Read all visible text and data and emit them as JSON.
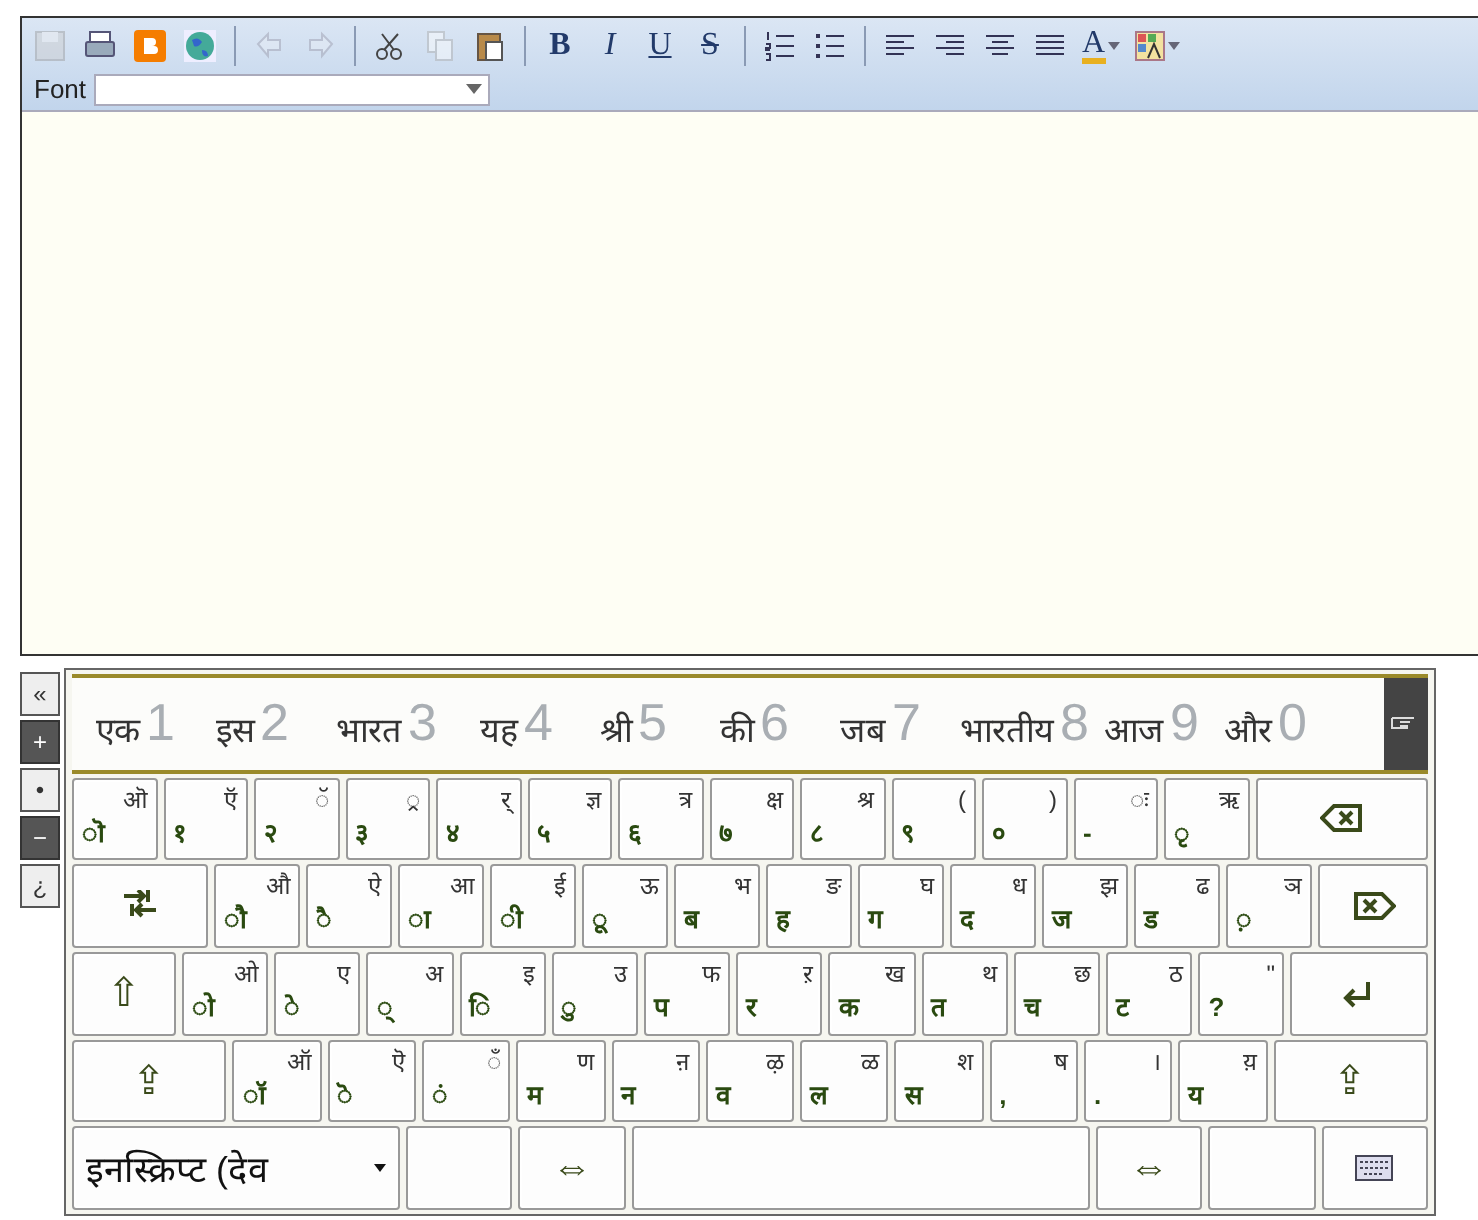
{
  "toolbar": {
    "buttons": [
      {
        "kind": "save",
        "disabled": true
      },
      {
        "kind": "print",
        "disabled": false
      },
      {
        "kind": "blog",
        "disabled": false
      },
      {
        "kind": "globe",
        "disabled": false
      },
      {
        "kind": "sep"
      },
      {
        "kind": "undo",
        "disabled": true
      },
      {
        "kind": "redo",
        "disabled": true
      },
      {
        "kind": "sep"
      },
      {
        "kind": "cut",
        "disabled": false
      },
      {
        "kind": "copy",
        "disabled": true
      },
      {
        "kind": "paste",
        "disabled": false
      },
      {
        "kind": "sep"
      },
      {
        "kind": "bold",
        "label": "B"
      },
      {
        "kind": "italic",
        "label": "I"
      },
      {
        "kind": "underline",
        "label": "U"
      },
      {
        "kind": "strike",
        "label": "S"
      },
      {
        "kind": "sep"
      },
      {
        "kind": "ordered-list",
        "disabled": false
      },
      {
        "kind": "bullet-list",
        "disabled": false
      },
      {
        "kind": "sep"
      },
      {
        "kind": "align-left",
        "disabled": false
      },
      {
        "kind": "align-right",
        "disabled": false
      },
      {
        "kind": "align-center",
        "disabled": false
      },
      {
        "kind": "justify",
        "disabled": false
      },
      {
        "kind": "font-color",
        "label": "A"
      },
      {
        "kind": "highlight"
      }
    ],
    "font": {
      "label": "Font"
    }
  },
  "side_buttons": [
    "«",
    "+",
    "•",
    "−",
    "¿"
  ],
  "suggestions": [
    {
      "word": "एक",
      "hint": "1"
    },
    {
      "word": "इस",
      "hint": "2"
    },
    {
      "word": "भारत",
      "hint": "3"
    },
    {
      "word": "यह",
      "hint": "4"
    },
    {
      "word": "श्री",
      "hint": "5"
    },
    {
      "word": "की",
      "hint": "6"
    },
    {
      "word": "जब",
      "hint": "7"
    },
    {
      "word": "भारतीय",
      "hint": "8"
    },
    {
      "word": "आज",
      "hint": "9"
    },
    {
      "word": "और",
      "hint": "0"
    }
  ],
  "keys": [
    [
      {
        "kind": "char",
        "lower": "ॊ",
        "upper": "ऒ"
      },
      {
        "kind": "char",
        "lower": "१",
        "upper": "ऍ"
      },
      {
        "kind": "char",
        "lower": "२",
        "upper": "ॅ"
      },
      {
        "kind": "char",
        "lower": "३",
        "upper": "्र"
      },
      {
        "kind": "char",
        "lower": "४",
        "upper": "र्"
      },
      {
        "kind": "char",
        "lower": "५",
        "upper": "ज्ञ"
      },
      {
        "kind": "char",
        "lower": "६",
        "upper": "त्र"
      },
      {
        "kind": "char",
        "lower": "७",
        "upper": "क्ष"
      },
      {
        "kind": "char",
        "lower": "८",
        "upper": "श्र"
      },
      {
        "kind": "char",
        "lower": "९",
        "upper": "("
      },
      {
        "kind": "char",
        "lower": "०",
        "upper": ")"
      },
      {
        "kind": "char",
        "lower": "-",
        "upper": "ः"
      },
      {
        "kind": "char",
        "lower": "ृ",
        "upper": "ऋ"
      },
      {
        "kind": "backspace"
      }
    ],
    [
      {
        "kind": "tab"
      },
      {
        "kind": "char",
        "lower": "ौ",
        "upper": "औ"
      },
      {
        "kind": "char",
        "lower": "ै",
        "upper": "ऐ"
      },
      {
        "kind": "char",
        "lower": "ा",
        "upper": "आ"
      },
      {
        "kind": "char",
        "lower": "ी",
        "upper": "ई"
      },
      {
        "kind": "char",
        "lower": "ू",
        "upper": "ऊ"
      },
      {
        "kind": "char",
        "lower": "ब",
        "upper": "भ"
      },
      {
        "kind": "char",
        "lower": "ह",
        "upper": "ङ"
      },
      {
        "kind": "char",
        "lower": "ग",
        "upper": "घ"
      },
      {
        "kind": "char",
        "lower": "द",
        "upper": "ध"
      },
      {
        "kind": "char",
        "lower": "ज",
        "upper": "झ"
      },
      {
        "kind": "char",
        "lower": "ड",
        "upper": "ढ"
      },
      {
        "kind": "char",
        "lower": "़",
        "upper": "ञ"
      },
      {
        "kind": "delete"
      }
    ],
    [
      {
        "kind": "caps",
        "label": "⇧"
      },
      {
        "kind": "char",
        "lower": "ो",
        "upper": "ओ"
      },
      {
        "kind": "char",
        "lower": "े",
        "upper": "ए"
      },
      {
        "kind": "char",
        "lower": "्",
        "upper": "अ"
      },
      {
        "kind": "char",
        "lower": "ि",
        "upper": "इ"
      },
      {
        "kind": "char",
        "lower": "ु",
        "upper": "उ"
      },
      {
        "kind": "char",
        "lower": "प",
        "upper": "फ"
      },
      {
        "kind": "char",
        "lower": "र",
        "upper": "ऱ"
      },
      {
        "kind": "char",
        "lower": "क",
        "upper": "ख"
      },
      {
        "kind": "char",
        "lower": "त",
        "upper": "थ"
      },
      {
        "kind": "char",
        "lower": "च",
        "upper": "छ"
      },
      {
        "kind": "char",
        "lower": "ट",
        "upper": "ठ"
      },
      {
        "kind": "char",
        "lower": "?",
        "upper": "\""
      },
      {
        "kind": "enter"
      }
    ],
    [
      {
        "kind": "shift",
        "label": "⇪"
      },
      {
        "kind": "char",
        "lower": "ॉ",
        "upper": "ऑ"
      },
      {
        "kind": "char",
        "lower": "ॆ",
        "upper": "ऎ"
      },
      {
        "kind": "char",
        "lower": "ं",
        "upper": "ँ"
      },
      {
        "kind": "char",
        "lower": "म",
        "upper": "ण"
      },
      {
        "kind": "char",
        "lower": "न",
        "upper": "ऩ"
      },
      {
        "kind": "char",
        "lower": "व",
        "upper": "ऴ"
      },
      {
        "kind": "char",
        "lower": "ल",
        "upper": "ळ"
      },
      {
        "kind": "char",
        "lower": "स",
        "upper": "श"
      },
      {
        "kind": "char",
        "lower": ",",
        "upper": "ष"
      },
      {
        "kind": "char",
        "lower": ".",
        "upper": "।"
      },
      {
        "kind": "char",
        "lower": "य",
        "upper": "य़"
      },
      {
        "kind": "shift",
        "label": "⇪"
      }
    ],
    [
      {
        "kind": "layout",
        "label": "इनस्क्रिप्ट (देव"
      },
      {
        "kind": "blank"
      },
      {
        "kind": "arrows",
        "label": "⇔"
      },
      {
        "kind": "space"
      },
      {
        "kind": "arrows",
        "label": "⇔"
      },
      {
        "kind": "blank"
      },
      {
        "kind": "keyboard"
      }
    ]
  ]
}
